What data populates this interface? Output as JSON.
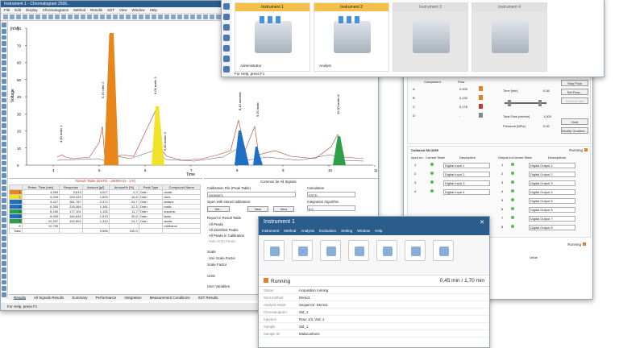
{
  "chrom": {
    "title": "Instrument 1 - Chromatogram 2506..",
    "menu": [
      "File",
      "Edit",
      "Display",
      "Chromatograms",
      "Method",
      "Results",
      "SST",
      "View",
      "Window",
      "Help"
    ],
    "yunit": "[mV]",
    "xunit": "Time",
    "ylabel": "Voltage",
    "yticks": [
      "80",
      "70",
      "60",
      "50",
      "40",
      "30",
      "20",
      "10",
      "0"
    ],
    "xticks": [
      "4",
      "5",
      "6",
      "7",
      "8",
      "9",
      "10",
      "11"
    ],
    "peak_labels": [
      "4,00 malic 1",
      "5,20 citric 2",
      "6,00 malic 3",
      "6,80 acetic 4",
      "8,10 succinic",
      "9,20 lactic",
      "11,00 acetic 8"
    ],
    "results_title": "Result Table (ESTD - 25068-01 - UV)",
    "cols": [
      "",
      "Reten. Time [min]",
      "Response",
      "Amount [g/l]",
      "Amount% [%]",
      "Peak Type",
      "Compound Name"
    ],
    "rows": [
      [
        "1",
        "4,563",
        "3,613",
        "0,027",
        "0,3",
        "Ordn",
        "oxalic"
      ],
      [
        "2",
        "5,203",
        "253,325",
        "1,609",
        "16,8",
        "Ordn",
        "citric"
      ],
      [
        "3",
        "5,417",
        "361,767",
        "2,372",
        "24,7",
        "Ordn",
        "tartaric"
      ],
      [
        "4",
        "6,300",
        "215,384",
        "1,181",
        "12,3",
        "Ordn",
        "malic"
      ],
      [
        "5",
        "8,160",
        "177,101",
        "1,126",
        "11,7",
        "Ordn",
        "succinic"
      ],
      [
        "6",
        "8,930",
        "160,634",
        "1,970",
        "20,5",
        "Ordn",
        "lactic"
      ],
      [
        "7",
        "10,347",
        "152,802",
        "1,312",
        "13,7",
        "Ordn",
        "acetic"
      ],
      [
        "8",
        "10,795",
        "",
        "",
        "",
        "",
        "methanol"
      ],
      [
        "Total",
        "",
        "",
        "9,596",
        "100,0",
        "",
        ""
      ]
    ],
    "calib": {
      "header": "Common for All Signals",
      "file_label": "Calibration File (Peak Table)",
      "file": "250694F1",
      "calc_label": "Calculation",
      "calc": "ESTD",
      "open_stored": "Open with stored calibration",
      "integ_label": "Integration Algorithm",
      "integ": "6.0",
      "set": "Set...",
      "new": "New",
      "view": "View",
      "report_label": "Report in Result Table",
      "r1": "All Peaks",
      "r2": "All Identified Peaks",
      "r3": "All Peaks in Calibration",
      "r4": "Hide ISTD Peaks",
      "scale": "Scale",
      "log": "Use Scale Factor",
      "scale_factor": "Scale Factor",
      "units": "Units",
      "uservars": "User Variables"
    },
    "tabs": [
      "Results",
      "All Signals Results",
      "Summary",
      "Performance",
      "Integration",
      "Measurement Conditions",
      "SST Results"
    ],
    "status": "For Help, press F1"
  },
  "instruments": {
    "cards": [
      {
        "name": "Instrument 1",
        "user": "Administrator",
        "active": true
      },
      {
        "name": "Instrument 2",
        "user": "Analyst",
        "active": true
      },
      {
        "name": "Instrument 3",
        "user": "",
        "active": false
      },
      {
        "name": "Instrument 4",
        "user": "",
        "active": false
      }
    ],
    "help": "For Help, press F1"
  },
  "pump": {
    "running": "Running",
    "cols": [
      "Component",
      "Flow"
    ],
    "rows": [
      [
        "A",
        "0,000"
      ],
      [
        "B",
        "0,132"
      ],
      [
        "C",
        "0,176"
      ],
      [
        "D",
        "-"
      ]
    ],
    "time_label": "Time [min]",
    "time": "0,36",
    "total_label": "Total Flow [ml/min]",
    "total": "1,000",
    "pressure_label": "Pressure [MPa]",
    "pressure": "0,00",
    "stop": "Stop Flow",
    "setflow": "Set Flow...",
    "external": "External Idle",
    "hold": "Hold",
    "modify": "Modify Gradient...",
    "colibrick": "Colibrick SN 3255",
    "in_cols": [
      "Input no.",
      "Current State",
      "Description"
    ],
    "out_cols": [
      "Output no.",
      "Current State",
      "Descriptions"
    ],
    "inputs": [
      "Digital Input 1",
      "Digital Input 2",
      "Digital Input 3",
      "Digital Input 4"
    ],
    "outputs": [
      "Digital Output 1",
      "Digital Output 2",
      "Digital Output 3",
      "Digital Output 4",
      "Digital Output 5",
      "Digital Output 6",
      "Digital Output 7",
      "Digital Output 8"
    ],
    "value": "Value"
  },
  "inst1": {
    "title": "Instrument 1",
    "menu": [
      "Instrument",
      "Method",
      "Analysis",
      "Evaluation",
      "Setting",
      "Window",
      "Help"
    ],
    "running": "Running",
    "progress": "0,45 min / 1,70 min",
    "fields": [
      [
        "Status",
        "Acquisition running"
      ],
      [
        "Sent method",
        "Demo1"
      ],
      [
        "Analysis Mode",
        "Sequence: Demo1"
      ],
      [
        "Chromatogram",
        "Std_1"
      ],
      [
        "Injection",
        "Row: 1/3, Vial: 1"
      ],
      [
        "Sample",
        "Std_1"
      ],
      [
        "Sample ID",
        "Maliocarbons"
      ]
    ]
  }
}
